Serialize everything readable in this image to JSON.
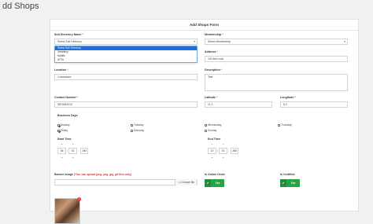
{
  "page": {
    "title": "dd Shops"
  },
  "form": {
    "header": "Add Shops Form",
    "sub_directory": {
      "label": "Sub Directory Name",
      "value": "Select Sub Directory",
      "options": [
        "Select Sub Directory",
        "Jewellery",
        "Mobile",
        "ATTA"
      ]
    },
    "membership": {
      "label": "Membership",
      "value": "Select Membership"
    },
    "address": {
      "label": "Address",
      "value": "100 feet road"
    },
    "location": {
      "label": "Location",
      "value": "Coimbatore"
    },
    "description": {
      "label": "Description",
      "value": "Test"
    },
    "contact": {
      "label": "Contact Number",
      "value": "9874563210"
    },
    "latitude": {
      "label": "Latitude",
      "value": "11.2"
    },
    "longitude": {
      "label": "Longitude",
      "value": "8.3"
    },
    "business_days": {
      "label": "Business Days",
      "days": [
        {
          "name": "Monday",
          "checked": true
        },
        {
          "name": "Tuesday",
          "checked": false
        },
        {
          "name": "Wednesday",
          "checked": false
        },
        {
          "name": "Thursday",
          "checked": false
        },
        {
          "name": "Friday",
          "checked": true
        },
        {
          "name": "Saturday",
          "checked": false
        },
        {
          "name": "Sunday",
          "checked": false
        }
      ]
    },
    "start_time": {
      "label": "Start Time",
      "hour": "06",
      "minute": "01",
      "ampm": "AM"
    },
    "end_time": {
      "label": "End Time",
      "hour": "10",
      "minute": "01",
      "ampm": "AM"
    },
    "banner": {
      "label": "Banner Image",
      "hint": "(*You can upload jpeg, png, jpg, gif files only)",
      "choose_label": "Choose file"
    },
    "online_order": {
      "label": "Is Online Order",
      "toggle": "Yes"
    },
    "certified": {
      "label": "Is Certified",
      "toggle": "Yes"
    },
    "required_mark": "*"
  },
  "icons": {
    "caret": "chevron-down-icon",
    "up": "chevron-up-icon",
    "down": "chevron-down-icon",
    "check": "check-icon",
    "close": "close-icon",
    "file": "file-icon"
  },
  "colors": {
    "accent": "#1e6ee0",
    "toggle_on": "#27a544",
    "required": "#e5343d"
  }
}
